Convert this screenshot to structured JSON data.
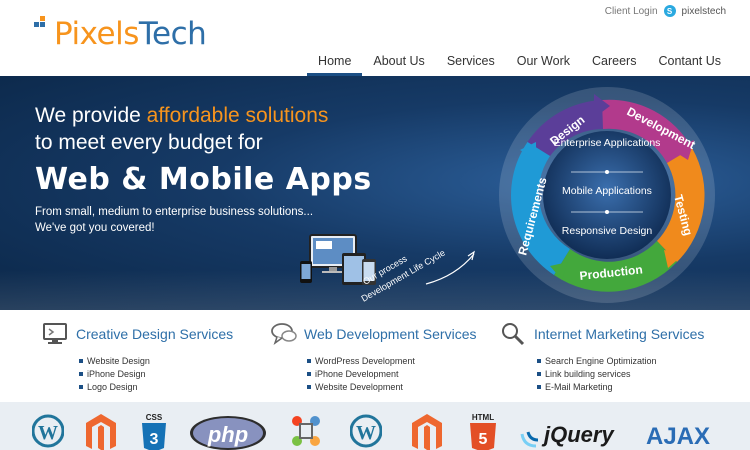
{
  "brand": {
    "name_part1": "Pixels",
    "name_part2": "Tech",
    "colors": {
      "orange": "#f7941d",
      "blue": "#2e6fa8",
      "navy": "#1b4f85"
    }
  },
  "topbar": {
    "client_login": "Client Login",
    "skype_name": "pixelstech",
    "skype_icon": "skype-icon"
  },
  "nav": {
    "items": [
      {
        "label": "Home",
        "active": true
      },
      {
        "label": "About Us",
        "active": false
      },
      {
        "label": "Services",
        "active": false
      },
      {
        "label": "Our Work",
        "active": false
      },
      {
        "label": "Careers",
        "active": false
      },
      {
        "label": "Contant Us",
        "active": false
      }
    ]
  },
  "hero": {
    "line1_prefix": "We provide ",
    "line1_highlight": "affordable solutions",
    "line2": "to meet every budget for",
    "line3": "Web & Mobile Apps",
    "sub1": "From small, medium to enterprise business solutions...",
    "sub2": "We've got you covered!",
    "process_line1": "Our process",
    "process_line2": "Development Life Cycle",
    "wheel": {
      "stages": [
        "Design",
        "Development",
        "Testing",
        "Production",
        "Requirements"
      ],
      "center": [
        "Enterprise Applications",
        "Mobile Applications",
        "Responsive Design"
      ]
    }
  },
  "services": [
    {
      "title": "Creative Design Services",
      "icon": "monitor-icon",
      "items": [
        "Website Design",
        "iPhone Design",
        "Logo Design"
      ]
    },
    {
      "title": "Web Development Services",
      "icon": "chat-bubbles-icon",
      "items": [
        "WordPress Development",
        "iPhone Development",
        "Website Development"
      ]
    },
    {
      "title": "Internet Marketing Services",
      "icon": "magnifier-icon",
      "items": [
        "Search Engine Optimization",
        "Link building services",
        "E-Mail Marketing"
      ]
    }
  ],
  "tech_logos": [
    {
      "name": "wordpress-icon"
    },
    {
      "name": "magento-icon"
    },
    {
      "name": "css3-icon",
      "label": "CSS"
    },
    {
      "name": "php-icon",
      "label": "php"
    },
    {
      "name": "joomla-icon"
    },
    {
      "name": "wordpress-icon"
    },
    {
      "name": "magento-icon"
    },
    {
      "name": "html5-icon",
      "label": "HTML"
    },
    {
      "name": "jquery-icon",
      "label": "jQuery"
    },
    {
      "name": "ajax-icon",
      "label": "AJAX"
    }
  ]
}
